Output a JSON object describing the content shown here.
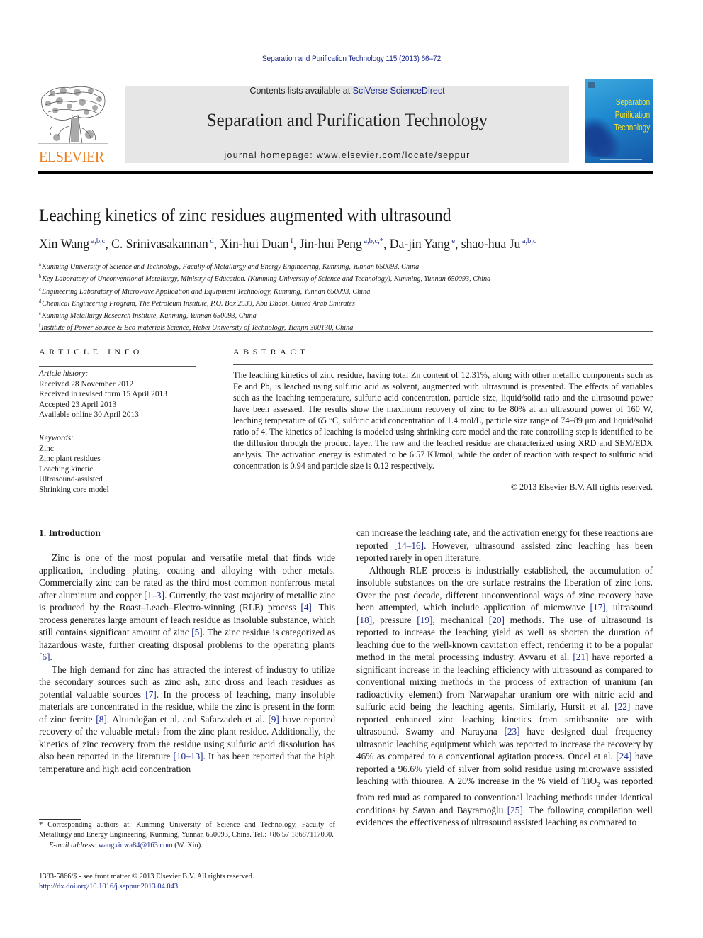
{
  "running_head": "Separation and Purification Technology 115 (2013) 66–72",
  "banner": {
    "contents_prefix": "Contents lists available at ",
    "contents_link": "SciVerse ScienceDirect",
    "journal_title": "Separation and Purification Technology",
    "homepage": "journal homepage: www.elsevier.com/locate/seppur"
  },
  "publisher_logo": {
    "wordmark": "ELSEVIER",
    "color": "#ef7d1c"
  },
  "cover": {
    "line1": "Separation",
    "line2": "Purification",
    "line3": "Technology",
    "text_color": "#f6e22a",
    "bg_color": "#1f8ad0"
  },
  "article": {
    "title": "Leaching kinetics of zinc residues augmented with ultrasound",
    "authors": [
      {
        "name": "Xin Wang",
        "sup": "a,b,c",
        "sep": ", "
      },
      {
        "name": "C. Srinivasakannan",
        "sup": "d",
        "sep": ", "
      },
      {
        "name": "Xin-hui Duan",
        "sup": "f",
        "sep": ", "
      },
      {
        "name": "Jin-hui Peng",
        "sup": "a,b,c,*",
        "sep": ", "
      },
      {
        "name": "Da-jin Yang",
        "sup": "e",
        "sep": ", "
      },
      {
        "name": "shao-hua Ju",
        "sup": "a,b,c",
        "sep": ""
      }
    ],
    "affiliations": [
      {
        "key": "a",
        "text": "Kunming University of Science and Technology, Faculty of Metallurgy and Energy Engineering, Kunming, Yunnan 650093, China"
      },
      {
        "key": "b",
        "text": "Key Laboratory of Unconventional Metallurgy, Ministry of Education. (Kunming University of Science and Technology), Kunming, Yunnan 650093, China"
      },
      {
        "key": "c",
        "text": "Engineering Laboratory of Microwave Application and Equipment Technology, Kunming, Yunnan 650093, China"
      },
      {
        "key": "d",
        "text": "Chemical Engineering Program, The Petroleum Institute, P.O. Box 2533, Abu Dhabi, United Arab Emirates"
      },
      {
        "key": "e",
        "text": "Kunming Metallurgy Research Institute, Kunming, Yunnan 650093, China"
      },
      {
        "key": "f",
        "text": "Institute of Power Source & Eco-materials Science, Hebei University of Technology, Tianjin 300130, China"
      }
    ]
  },
  "article_info": {
    "heading": "ARTICLE INFO",
    "history_label": "Article history:",
    "history": [
      "Received 28 November 2012",
      "Received in revised form 15 April 2013",
      "Accepted 23 April 2013",
      "Available online 30 April 2013"
    ],
    "keywords_label": "Keywords:",
    "keywords": [
      "Zinc",
      "Zinc plant residues",
      "Leaching kinetic",
      "Ultrasound-assisted",
      "Shrinking core model"
    ]
  },
  "abstract": {
    "heading": "ABSTRACT",
    "text": "The leaching kinetics of zinc residue, having total Zn content of 12.31%, along with other metallic com­ponents such as Fe and Pb, is leached using sulfuric acid as solvent, augmented with ultrasound is pre­sented. The effects of variables such as the leaching temperature, sulfuric acid concentration, particle size, liquid/solid ratio and the ultrasound power have been assessed. The results show the maximum recovery of zinc to be 80% at an ultrasound power of 160 W, leaching temperature of 65 °C, sulfuric acid concentration of 1.4 mol/L, particle size range of 74–89 μm and liquid/solid ratio of 4. The kinetics of leaching is modeled using shrinking core model and the rate controlling step is identified to be the dif­fusion through the product layer. The raw and the leached residue are characterized using XRD and SEM/EDX analysis. The activation energy is estimated to be 6.57 KJ/mol, while the order of reaction with respect to sulfuric acid concentration is 0.94 and particle size is 0.12 respectively.",
    "copyright": "© 2013 Elsevier B.V. All rights reserved."
  },
  "introduction": {
    "heading": "1. Introduction",
    "left_paragraphs": [
      [
        {
          "t": "Zinc is one of the most popular and versatile metal that finds wide application, including plating, coating and alloying with other metals. Commercially zinc can be rated as the third most common nonferrous metal after aluminum and copper "
        },
        {
          "c": "[1–3]"
        },
        {
          "t": ". Currently, the vast majority of metallic zinc is produced by the Roast–Leach–Elec­tro-winning (RLE) process "
        },
        {
          "c": "[4]"
        },
        {
          "t": ". This process generates large amount of leach residue as insoluble substance, which still contains signif­icant amount of zinc "
        },
        {
          "c": "[5]"
        },
        {
          "t": ". The zinc residue is categorized as hazard­ous waste, further creating disposal problems to the operating plants "
        },
        {
          "c": "[6]"
        },
        {
          "t": "."
        }
      ],
      [
        {
          "t": "The high demand for zinc has attracted the interest of industry to utilize the secondary sources such as zinc ash, zinc dross and leach residues as potential valuable sources "
        },
        {
          "c": "[7]"
        },
        {
          "t": ". In the process of leaching, many insoluble materials are concentrated in the residue, while the zinc is present in the form of zinc ferrite "
        },
        {
          "c": "[8]"
        },
        {
          "t": ". Altundoğan et al. and Safarzadeh et al. "
        },
        {
          "c": "[9]"
        },
        {
          "t": " have reported recovery of the valu­able metals from the zinc plant residue. Additionally, the kinetics of zinc recovery from the residue using sulfuric acid dissolution has also been reported in the literature "
        },
        {
          "c": "[10–13]"
        },
        {
          "t": ". It has been re­ported that the high temperature and high acid concentration"
        }
      ]
    ],
    "right_paragraphs": [
      [
        {
          "t": "can increase the leaching rate, and the activation energy for these reactions are reported "
        },
        {
          "c": "[14–16]"
        },
        {
          "t": ". However, ultrasound assisted zinc leaching has been reported rarely in open literature."
        }
      ],
      [
        {
          "t": "Although RLE process is industrially established, the accumula­tion of insoluble substances on the ore surface restrains the liber­ation of zinc ions. Over the past decade, different unconventional ways of zinc recovery have been attempted, which include applica­tion of microwave "
        },
        {
          "c": "[17]"
        },
        {
          "t": ", ultrasound "
        },
        {
          "c": "[18]"
        },
        {
          "t": ", pressure "
        },
        {
          "c": "[19]"
        },
        {
          "t": ", mechanical "
        },
        {
          "c": "[20]"
        },
        {
          "t": " methods. The use of ultrasound is reported to increase the leaching yield as well as shorten the duration of leaching due to the well-known cavitation effect, rendering it to be a popular method in the metal processing industry. Avvaru et al. "
        },
        {
          "c": "[21]"
        },
        {
          "t": " have reported a significant increase in the leaching efficiency with ultra­sound as compared to conventional mixing methods in the process of extraction of uranium (an radioactivity element) from Narwap­ahar uranium ore with nitric acid and sulfuric acid being the leach­ing agents. Similarly, Hursit et al. "
        },
        {
          "c": "[22]"
        },
        {
          "t": " have reported enhanced zinc leaching kinetics from smithsonite ore with ultrasound. Swamy and Narayana "
        },
        {
          "c": "[23]"
        },
        {
          "t": " have designed dual frequency ultrasonic leach­ing equipment which was reported to increase the recovery by 46% as compared to a conventional agitation process. Öncel et al. "
        },
        {
          "c": "[24]"
        },
        {
          "t": " have reported a 96.6% yield of silver from solid residue using microwave assisted leaching with thiourea. A 20% increase in the % yield of TiO"
        },
        {
          "sub": "2"
        },
        {
          "t": " was reported from red mud as compared to conven­tional leaching methods under identical conditions by Sayan and Bayramoğlu "
        },
        {
          "c": "[25]"
        },
        {
          "t": ". The following compilation well evidences the effectiveness of ultrasound assisted leaching as compared to"
        }
      ]
    ]
  },
  "footnote": {
    "corresponding": "* Corresponding authors at: Kunming University of Science and Technology, Faculty of Metallurgy and Energy Engineering, Kunming, Yunnan 650093, China. Tel.: +86 57 18687117030.",
    "email_label": "E-mail address: ",
    "email": "wangxinwa84@163.com",
    "email_suffix": " (W. Xin)."
  },
  "front_matter": {
    "issn_line": "1383-5866/$ - see front matter © 2013 Elsevier B.V. All rights reserved.",
    "doi": "http://dx.doi.org/10.1016/j.seppur.2013.04.043"
  }
}
